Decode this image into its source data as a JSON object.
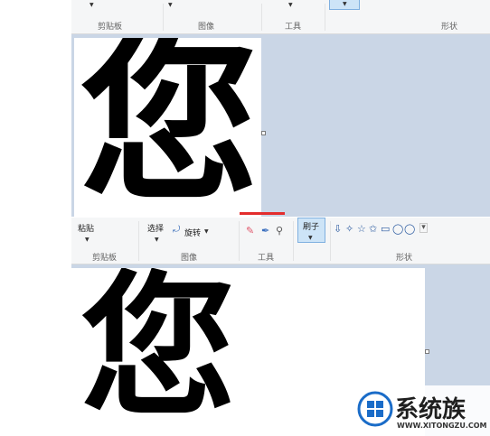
{
  "top": {
    "groups": {
      "clipboard": "剪贴板",
      "image": "图像",
      "tools": "工具",
      "shapes": "形状"
    },
    "character": "您"
  },
  "bottom": {
    "buttons": {
      "paste": "粘贴",
      "select": "选择",
      "rotate": "旋转",
      "brush": "刷子"
    },
    "groups": {
      "clipboard": "剪贴板",
      "image": "图像",
      "tools": "工具",
      "shapes": "形状"
    },
    "character": "您",
    "shapes_icons": [
      "⇩",
      "✧",
      "☆",
      "✩",
      "▭",
      "◯",
      "◯",
      "▭"
    ],
    "dropdown_glyph": "▾"
  },
  "watermark": {
    "title": "系统族",
    "url": "WWW.XITONGZU.COM"
  },
  "colors": {
    "ribbon_bg": "#f5f6f7",
    "workarea_bg": "#cad6e6",
    "brush_active_bg": "#cde4f7",
    "red_marker": "#e32d2d",
    "logo_blue": "#1a6cc8"
  }
}
